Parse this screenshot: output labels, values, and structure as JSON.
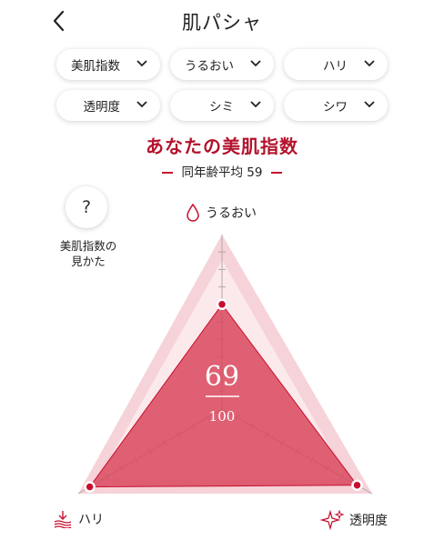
{
  "header": {
    "logo": "肌パシャ"
  },
  "filters": [
    {
      "label": "美肌指数"
    },
    {
      "label": "うるおい"
    },
    {
      "label": "ハリ"
    },
    {
      "label": "透明度"
    },
    {
      "label": "シミ"
    },
    {
      "label": "シワ"
    }
  ],
  "main": {
    "title": "あなたの美肌指数",
    "average": "同年齢平均 59",
    "help_mark": "?",
    "help_label_line1": "美肌指数の",
    "help_label_line2": "見かた"
  },
  "radar": {
    "score": "69",
    "max": "100",
    "axes": [
      "うるおい",
      "ハリ",
      "透明度"
    ],
    "values": {
      "うるおい": 0.6,
      "ハリ": 0.92,
      "透明度": 0.9
    },
    "colors": {
      "accent": "#c8102e",
      "fill": "#d9485e",
      "outer": "#f6d3d9"
    }
  }
}
